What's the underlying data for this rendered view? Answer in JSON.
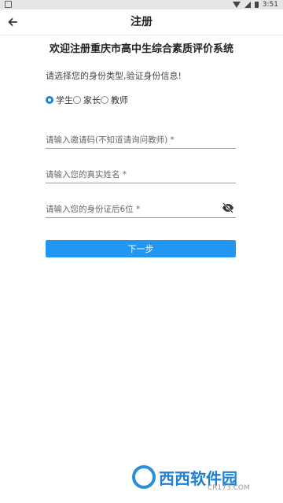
{
  "status_bar": {
    "time": "3:51"
  },
  "toolbar": {
    "title": "注册"
  },
  "welcome": "欢迎注册重庆市高中生综合素质评价系统",
  "prompt": "请选择您的身份类型,验证身份信息!",
  "identity": {
    "options": [
      "学生",
      "家长",
      "教师"
    ],
    "selected": "学生"
  },
  "fields": {
    "invite_code_placeholder": "请输入邀请码(不知道请询问教师) *",
    "real_name_placeholder": "请输入您的真实姓名 *",
    "id_last6_placeholder": "请输入您的身份证后6位 *"
  },
  "next_button": "下一步",
  "watermark": {
    "brand": "西西软件园",
    "site": "CR173.COM"
  },
  "colors": {
    "accent": "#2196f3",
    "radio_checked": "#1f86d3"
  }
}
